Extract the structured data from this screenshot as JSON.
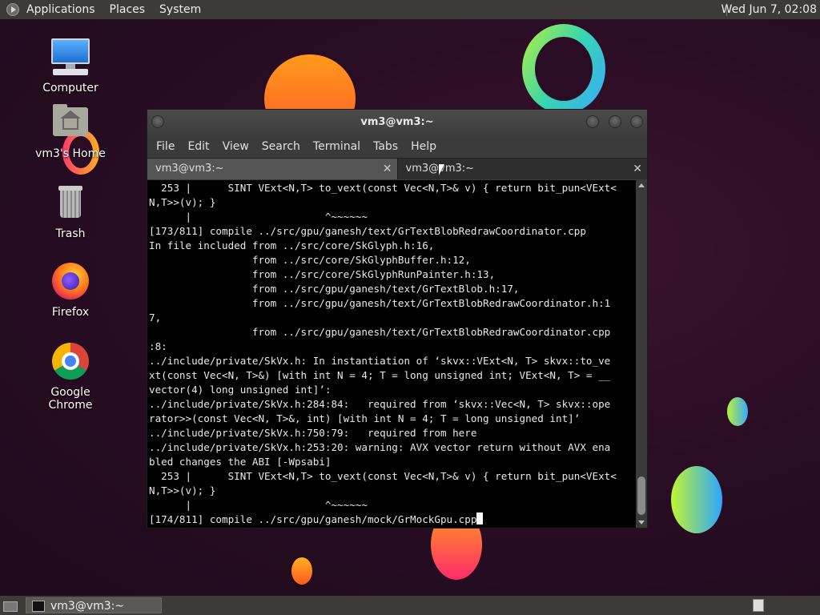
{
  "top_panel": {
    "menus": [
      "Applications",
      "Places",
      "System"
    ],
    "clock": "Wed Jun  7, 02:08"
  },
  "desktop_icons": [
    {
      "label": "Computer",
      "icon": "computer-icon"
    },
    {
      "label": "vm3's Home",
      "icon": "home-folder-icon"
    },
    {
      "label": "Trash",
      "icon": "trash-icon"
    },
    {
      "label": "Firefox",
      "icon": "firefox-icon"
    },
    {
      "label": "Google Chrome",
      "icon": "chrome-icon"
    }
  ],
  "window": {
    "title": "vm3@vm3:~",
    "menu": [
      "File",
      "Edit",
      "View",
      "Search",
      "Terminal",
      "Tabs",
      "Help"
    ],
    "tabs": [
      {
        "label": "vm3@vm3:~",
        "active": true
      },
      {
        "label": "vm3@vm3:~",
        "active": false
      }
    ],
    "terminal_lines": [
      "  253 |      SINT VExt<N,T> to_vext(const Vec<N,T>& v) { return bit_pun<VExt<",
      "N,T>>(v); }",
      "      |                      ^~~~~~~",
      "[173/811] compile ../src/gpu/ganesh/text/GrTextBlobRedrawCoordinator.cpp",
      "In file included from ../src/core/SkGlyph.h:16,",
      "                 from ../src/core/SkGlyphBuffer.h:12,",
      "                 from ../src/core/SkGlyphRunPainter.h:13,",
      "                 from ../src/gpu/ganesh/text/GrTextBlob.h:17,",
      "                 from ../src/gpu/ganesh/text/GrTextBlobRedrawCoordinator.h:1",
      "7,",
      "                 from ../src/gpu/ganesh/text/GrTextBlobRedrawCoordinator.cpp",
      ":8:",
      "../include/private/SkVx.h: In instantiation of ‘skvx::VExt<N, T> skvx::to_ve",
      "xt(const Vec<N, T>&) [with int N = 4; T = long unsigned int; VExt<N, T> = __",
      "vector(4) long unsigned int]’:",
      "../include/private/SkVx.h:284:84:   required from ‘skvx::Vec<N, T> skvx::ope",
      "rator>>(const Vec<N, T>&, int) [with int N = 4; T = long unsigned int]’",
      "../include/private/SkVx.h:750:79:   required from here",
      "../include/private/SkVx.h:253:20: warning: AVX vector return without AVX ena",
      "bled changes the ABI [-Wpsabi]",
      "  253 |      SINT VExt<N,T> to_vext(const Vec<N,T>& v) { return bit_pun<VExt<",
      "N,T>>(v); }",
      "      |                      ^~~~~~~"
    ],
    "prompt_line": "[174/811] compile ../src/gpu/ganesh/mock/GrMockGpu.cpp"
  },
  "bottom_panel": {
    "task_label": "vm3@vm3:~"
  }
}
